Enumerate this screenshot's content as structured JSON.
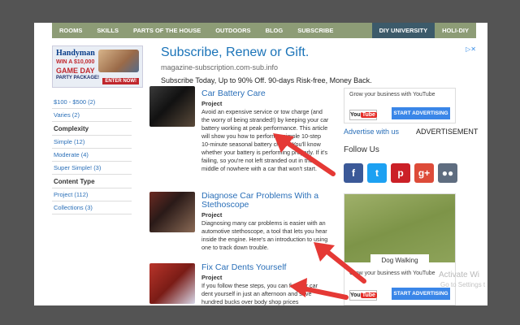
{
  "nav": {
    "items": [
      "ROOMS",
      "SKILLS",
      "PARTS OF THE HOUSE",
      "OUTDOORS",
      "BLOG",
      "SUBSCRIBE"
    ],
    "right_items": [
      "DIY UNIVERSITY",
      "HOLI-DIY"
    ]
  },
  "top_ad": {
    "brand": "Handyman",
    "line1": "WIN A $10,000",
    "line2": "GAME DAY",
    "line3": "PARTY PACKAGE!",
    "enter": "ENTER NOW!",
    "headline": "Subscribe, Renew or Gift.",
    "url": "magazine-subscription.com-sub.info",
    "description": "Subscribe Today, Up to 90% Off. 90-days Risk-free, Money Back.",
    "close": "▷✕"
  },
  "sidebar": {
    "cost_items": [
      "$100 - $500 (2)",
      "Varies (2)"
    ],
    "complexity_heading": "Complexity",
    "complexity_items": [
      "Simple (12)",
      "Moderate (4)",
      "Super Simple! (3)"
    ],
    "content_type_heading": "Content Type",
    "content_type_items": [
      "Project (112)",
      "Collections (3)"
    ]
  },
  "articles": [
    {
      "title": "Car Battery Care",
      "type": "Project",
      "description": "Avoid an expensive service or tow charge (and the worry of being stranded!) by keeping your car battery working at peak performance. This article will show you how to perform a simple 10-step 10-minute seasonal battery check. You'll know whether your battery is performing properly. If it's failing, so you're not left stranded out in the middle of nowhere with a car that won't start."
    },
    {
      "title": "Diagnose Car Problems With a Stethoscope",
      "type": "Project",
      "description": "Diagnosing many car problems is easier with an automotive stethoscope, a tool that lets you hear inside the engine. Here's an introduction to using one to track down trouble."
    },
    {
      "title": "Fix Car Dents Yourself",
      "type": "Project",
      "description": "If you follow these steps, you can fix your car dent yourself in just an afternoon and save hundred bucks over body shop prices"
    }
  ],
  "right": {
    "yt_text": "Grow your business with YouTube",
    "yt_logo_you": "You",
    "yt_logo_tube": "Tube",
    "start_advertising": "START ADVERTISING",
    "advertise_link": "Advertise with us",
    "advertisement_label": "ADVERTISEMENT",
    "follow_us": "Follow Us",
    "social": [
      {
        "name": "facebook",
        "glyph": "f",
        "color": "#3b5998"
      },
      {
        "name": "twitter",
        "glyph": "t",
        "color": "#1da1f2"
      },
      {
        "name": "pinterest",
        "glyph": "p",
        "color": "#cb2027"
      },
      {
        "name": "googleplus",
        "glyph": "g+",
        "color": "#dd4b39"
      },
      {
        "name": "community",
        "glyph": "●●",
        "color": "#5f6d80"
      }
    ],
    "video_ad_label": "Dog Walking",
    "yt_text2": "Grow your business with YouTube",
    "start_advertising2": "START ADVERTISING"
  },
  "watermark": {
    "line1": "Activate Wi",
    "line2": "Go to Settings t"
  },
  "colors": {
    "nav_bg": "#8d9c76",
    "nav_dark": "#3c5a6a",
    "link": "#2a6fb8",
    "arrow": "#e53935"
  }
}
